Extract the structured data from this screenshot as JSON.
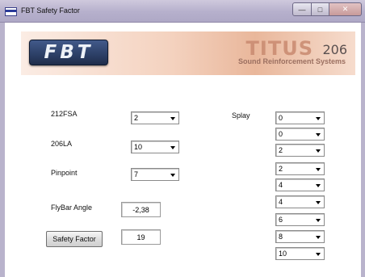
{
  "window": {
    "title": "FBT Safety Factor"
  },
  "banner": {
    "brand": "FBT",
    "product_word": "TITUS",
    "product_number": "206",
    "product_subtitle": "Sound Reinforcement Systems"
  },
  "form": {
    "fsa_label": "212FSA",
    "fsa_value": "2",
    "la_label": "206LA",
    "la_value": "10",
    "pinpoint_label": "Pinpoint",
    "pinpoint_value": "7",
    "flybar_label": "FlyBar Angle",
    "flybar_value": "-2,38",
    "safety_button": "Safety Factor",
    "safety_value": "19"
  },
  "splay": {
    "label": "Splay",
    "values": [
      "0",
      "0",
      "2",
      "2",
      "4",
      "4",
      "6",
      "8",
      "10"
    ]
  }
}
